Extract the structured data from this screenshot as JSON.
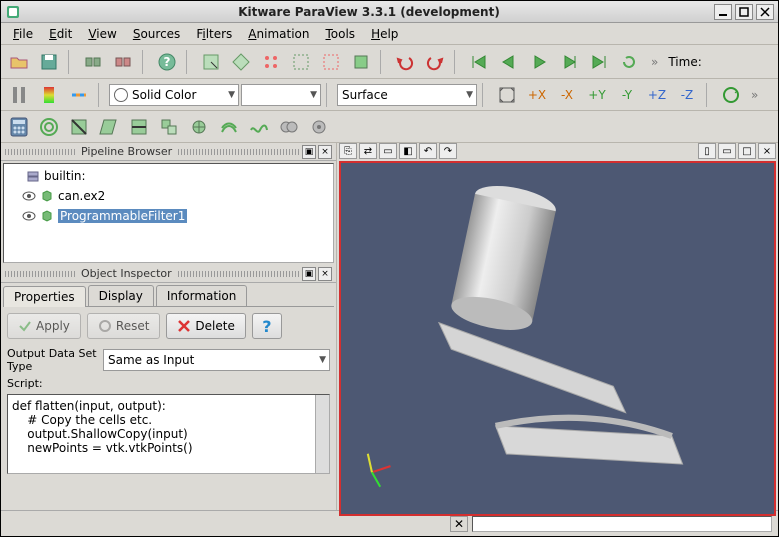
{
  "window": {
    "title": "Kitware ParaView 3.3.1 (development)"
  },
  "menu": {
    "file": "File",
    "edit": "Edit",
    "view": "View",
    "sources": "Sources",
    "filters": "Filters",
    "animation": "Animation",
    "tools": "Tools",
    "help": "Help"
  },
  "toolbar1": {
    "time_label": "Time:"
  },
  "toolbar2": {
    "coloring": "Solid Color",
    "representation": "Surface"
  },
  "pipeline": {
    "title": "Pipeline Browser",
    "items": [
      {
        "label": "builtin:",
        "icon": "server",
        "eye": false
      },
      {
        "label": "can.ex2",
        "icon": "cube-green",
        "eye": true
      },
      {
        "label": "ProgrammableFilter1",
        "icon": "cube-green",
        "eye": true,
        "selected": true
      }
    ]
  },
  "inspector": {
    "title": "Object Inspector",
    "tabs": {
      "properties": "Properties",
      "display": "Display",
      "information": "Information"
    },
    "buttons": {
      "apply": "Apply",
      "reset": "Reset",
      "delete": "Delete"
    },
    "output_label": "Output Data Set Type",
    "output_value": "Same as Input",
    "script_label": "Script:",
    "script_text": "def flatten(input, output):\n    # Copy the cells etc.\n    output.ShallowCopy(input)\n    newPoints = vtk.vtkPoints()"
  },
  "chart_data": null
}
